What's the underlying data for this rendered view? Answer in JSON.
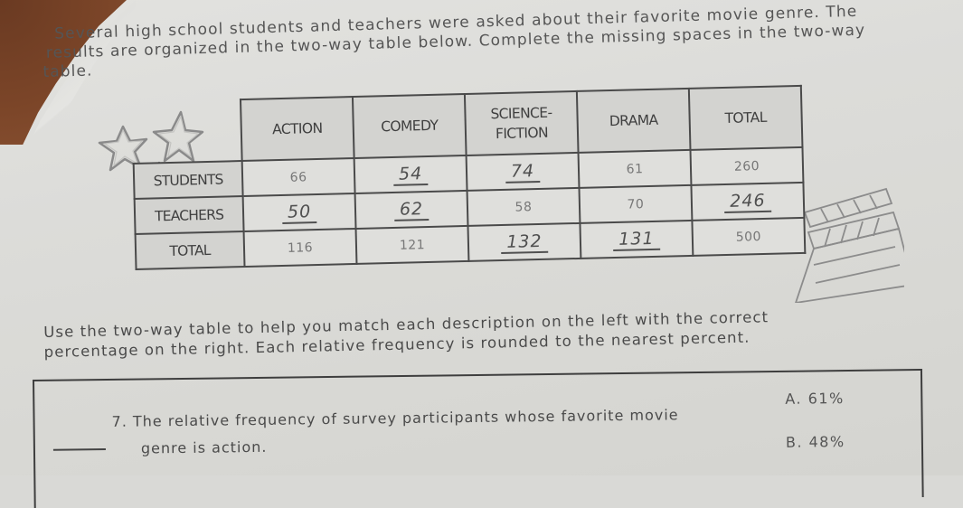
{
  "worksheet": {
    "intro": {
      "line1": "Several high school students and teachers were asked about their favorite movie genre. The",
      "line2": "results are organized in the two-way table below. Complete the missing spaces in the two-way",
      "line3": "table."
    },
    "table": {
      "columns": [
        "ACTION",
        "COMEDY",
        "SCIENCE-FICTION",
        "DRAMA",
        "TOTAL"
      ],
      "column_lines": {
        "science_fiction_1": "SCIENCE-",
        "science_fiction_2": "FICTION"
      },
      "rows": [
        {
          "label": "STUDENTS",
          "cells": [
            {
              "value": "66",
              "handwritten": false
            },
            {
              "value": "54",
              "handwritten": true
            },
            {
              "value": "74",
              "handwritten": true
            },
            {
              "value": "61",
              "handwritten": false
            },
            {
              "value": "260",
              "handwritten": false
            }
          ]
        },
        {
          "label": "TEACHERS",
          "cells": [
            {
              "value": "50",
              "handwritten": true
            },
            {
              "value": "62",
              "handwritten": true
            },
            {
              "value": "58",
              "handwritten": false
            },
            {
              "value": "70",
              "handwritten": false
            },
            {
              "value": "246",
              "handwritten": true
            }
          ]
        },
        {
          "label": "TOTAL",
          "cells": [
            {
              "value": "116",
              "handwritten": false
            },
            {
              "value": "121",
              "handwritten": false
            },
            {
              "value": "132",
              "handwritten": true
            },
            {
              "value": "131",
              "handwritten": true
            },
            {
              "value": "500",
              "handwritten": false
            }
          ]
        }
      ]
    },
    "instructions": {
      "line1": "Use the two-way table to help you match each description on the left with the correct",
      "line2": "percentage on the right. Each relative frequency is rounded to the nearest percent."
    },
    "matching": {
      "question_number": "7.",
      "question_line1": "The relative frequency of survey participants whose favorite movie",
      "question_line2": "genre is action.",
      "answer_blank": "",
      "choices": [
        {
          "letter": "A.",
          "value": "61%"
        },
        {
          "letter": "B.",
          "value": "48%"
        }
      ]
    },
    "decorations": {
      "left": "stars-icon",
      "right": "clapperboard-icon"
    }
  }
}
